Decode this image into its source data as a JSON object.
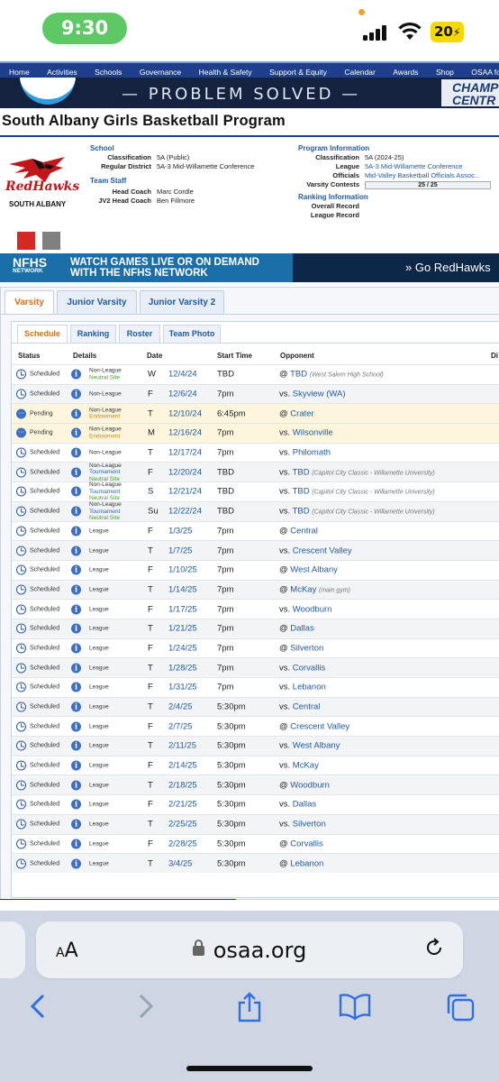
{
  "status_bar": {
    "time": "9:30",
    "battery": "20"
  },
  "nav": [
    "Home",
    "Activities",
    "Schools",
    "Governance",
    "Health & Safety",
    "Support & Equity",
    "Calendar",
    "Awards",
    "Shop",
    "OSAA for"
  ],
  "banner": {
    "text": "— PROBLEM SOLVED —",
    "right_text_1": "CHAMP",
    "right_text_2": "CENTR"
  },
  "page_title": "South Albany Girls Basketball Program",
  "logo": {
    "name": "RedHawks",
    "school": "SOUTH ALBANY"
  },
  "school": {
    "heading": "School",
    "classification_label": "Classification",
    "classification": "5A (Public)",
    "district_label": "Regular District",
    "district": "5A-3 Mid-Willamette Conference"
  },
  "staff": {
    "heading": "Team Staff",
    "head_coach_label": "Head Coach",
    "head_coach": "Marc Cordle",
    "jv2_label": "JV2 Head Coach",
    "jv2": "Ben Fillmore"
  },
  "program": {
    "heading": "Program Information",
    "classification_label": "Classification",
    "classification": "5A (2024-25)",
    "league_label": "League",
    "league": "5A-3 Mid-Willamette Conference",
    "officials_label": "Officials",
    "officials": "Mid-Valley Basketball Officials Assoc...",
    "contests_label": "Varsity Contests",
    "contests": "25 / 25",
    "contests_fill": 1.0
  },
  "ranking": {
    "heading": "Ranking Information",
    "overall_label": "Overall Record",
    "league_label": "League Record"
  },
  "colors": {
    "primary": "#d32a25",
    "secondary": "#808080"
  },
  "nfhs": {
    "logo": "NFHS",
    "logo_sub": "NETWORK",
    "line1": "WATCH GAMES LIVE OR ON DEMAND",
    "line2": "WITH THE NFHS NETWORK",
    "go": "» Go RedHawks"
  },
  "level_tabs": [
    "Varsity",
    "Junior Varsity",
    "Junior Varsity 2"
  ],
  "sub_tabs": [
    "Schedule",
    "Ranking",
    "Roster",
    "Team Photo"
  ],
  "columns": {
    "status": "Status",
    "details": "Details",
    "date": "Date",
    "start": "Start Time",
    "opponent": "Opponent",
    "extra": "Di"
  },
  "games": [
    {
      "status": "Scheduled",
      "d1": "Non-League",
      "d2": "Neutral Site",
      "d3": "",
      "day": "W",
      "date": "12/4/24",
      "time": "TBD",
      "prefix": "@",
      "opp": "TBD",
      "note": "(West Salem High School)"
    },
    {
      "status": "Scheduled",
      "d1": "Non-League",
      "d2": "",
      "d3": "",
      "day": "F",
      "date": "12/6/24",
      "time": "7pm",
      "prefix": "vs.",
      "opp": "Skyview (WA)",
      "note": ""
    },
    {
      "status": "Pending",
      "d1": "Non-League",
      "d2": "Endowment",
      "d3": "",
      "day": "T",
      "date": "12/10/24",
      "time": "6:45pm",
      "prefix": "@",
      "opp": "Crater",
      "note": ""
    },
    {
      "status": "Pending",
      "d1": "Non-League",
      "d2": "Endowment",
      "d3": "",
      "day": "M",
      "date": "12/16/24",
      "time": "7pm",
      "prefix": "vs.",
      "opp": "Wilsonville",
      "note": ""
    },
    {
      "status": "Scheduled",
      "d1": "Non-League",
      "d2": "",
      "d3": "",
      "day": "T",
      "date": "12/17/24",
      "time": "7pm",
      "prefix": "vs.",
      "opp": "Philomath",
      "note": ""
    },
    {
      "status": "Scheduled",
      "d1": "Non-League",
      "d2": "Tournament",
      "d3": "Neutral Site",
      "day": "F",
      "date": "12/20/24",
      "time": "TBD",
      "prefix": "vs.",
      "opp": "TBD",
      "note": "(Capitol City Classic - Willamette University)"
    },
    {
      "status": "Scheduled",
      "d1": "Non-League",
      "d2": "Tournament",
      "d3": "Neutral Site",
      "day": "S",
      "date": "12/21/24",
      "time": "TBD",
      "prefix": "vs.",
      "opp": "TBD",
      "note": "(Capitol City Classic - Willamette University)"
    },
    {
      "status": "Scheduled",
      "d1": "Non-League",
      "d2": "Tournament",
      "d3": "Neutral Site",
      "day": "Su",
      "date": "12/22/24",
      "time": "TBD",
      "prefix": "vs.",
      "opp": "TBD",
      "note": "(Capitol City Classic - Willamette University)"
    },
    {
      "status": "Scheduled",
      "d1": "League",
      "d2": "",
      "d3": "",
      "day": "F",
      "date": "1/3/25",
      "time": "7pm",
      "prefix": "@",
      "opp": "Central",
      "note": ""
    },
    {
      "status": "Scheduled",
      "d1": "League",
      "d2": "",
      "d3": "",
      "day": "T",
      "date": "1/7/25",
      "time": "7pm",
      "prefix": "vs.",
      "opp": "Crescent Valley",
      "note": ""
    },
    {
      "status": "Scheduled",
      "d1": "League",
      "d2": "",
      "d3": "",
      "day": "F",
      "date": "1/10/25",
      "time": "7pm",
      "prefix": "@",
      "opp": "West Albany",
      "note": ""
    },
    {
      "status": "Scheduled",
      "d1": "League",
      "d2": "",
      "d3": "",
      "day": "T",
      "date": "1/14/25",
      "time": "7pm",
      "prefix": "@",
      "opp": "McKay",
      "note": "(main gym)"
    },
    {
      "status": "Scheduled",
      "d1": "League",
      "d2": "",
      "d3": "",
      "day": "F",
      "date": "1/17/25",
      "time": "7pm",
      "prefix": "vs.",
      "opp": "Woodburn",
      "note": ""
    },
    {
      "status": "Scheduled",
      "d1": "League",
      "d2": "",
      "d3": "",
      "day": "T",
      "date": "1/21/25",
      "time": "7pm",
      "prefix": "@",
      "opp": "Dallas",
      "note": ""
    },
    {
      "status": "Scheduled",
      "d1": "League",
      "d2": "",
      "d3": "",
      "day": "F",
      "date": "1/24/25",
      "time": "7pm",
      "prefix": "@",
      "opp": "Silverton",
      "note": ""
    },
    {
      "status": "Scheduled",
      "d1": "League",
      "d2": "",
      "d3": "",
      "day": "T",
      "date": "1/28/25",
      "time": "7pm",
      "prefix": "vs.",
      "opp": "Corvallis",
      "note": ""
    },
    {
      "status": "Scheduled",
      "d1": "League",
      "d2": "",
      "d3": "",
      "day": "F",
      "date": "1/31/25",
      "time": "7pm",
      "prefix": "vs.",
      "opp": "Lebanon",
      "note": ""
    },
    {
      "status": "Scheduled",
      "d1": "League",
      "d2": "",
      "d3": "",
      "day": "T",
      "date": "2/4/25",
      "time": "5:30pm",
      "prefix": "vs.",
      "opp": "Central",
      "note": ""
    },
    {
      "status": "Scheduled",
      "d1": "League",
      "d2": "",
      "d3": "",
      "day": "F",
      "date": "2/7/25",
      "time": "5:30pm",
      "prefix": "@",
      "opp": "Crescent Valley",
      "note": ""
    },
    {
      "status": "Scheduled",
      "d1": "League",
      "d2": "",
      "d3": "",
      "day": "T",
      "date": "2/11/25",
      "time": "5:30pm",
      "prefix": "vs.",
      "opp": "West Albany",
      "note": ""
    },
    {
      "status": "Scheduled",
      "d1": "League",
      "d2": "",
      "d3": "",
      "day": "F",
      "date": "2/14/25",
      "time": "5:30pm",
      "prefix": "vs.",
      "opp": "McKay",
      "note": ""
    },
    {
      "status": "Scheduled",
      "d1": "League",
      "d2": "",
      "d3": "",
      "day": "T",
      "date": "2/18/25",
      "time": "5:30pm",
      "prefix": "@",
      "opp": "Woodburn",
      "note": ""
    },
    {
      "status": "Scheduled",
      "d1": "League",
      "d2": "",
      "d3": "",
      "day": "F",
      "date": "2/21/25",
      "time": "5:30pm",
      "prefix": "vs.",
      "opp": "Dallas",
      "note": ""
    },
    {
      "status": "Scheduled",
      "d1": "League",
      "d2": "",
      "d3": "",
      "day": "T",
      "date": "2/25/25",
      "time": "5:30pm",
      "prefix": "vs.",
      "opp": "Silverton",
      "note": ""
    },
    {
      "status": "Scheduled",
      "d1": "League",
      "d2": "",
      "d3": "",
      "day": "F",
      "date": "2/28/25",
      "time": "5:30pm",
      "prefix": "@",
      "opp": "Corvallis",
      "note": ""
    },
    {
      "status": "Scheduled",
      "d1": "League",
      "d2": "",
      "d3": "",
      "day": "T",
      "date": "3/4/25",
      "time": "5:30pm",
      "prefix": "@",
      "opp": "Lebanon",
      "note": ""
    }
  ],
  "browser": {
    "aa": "AA",
    "url": "osaa.org"
  }
}
